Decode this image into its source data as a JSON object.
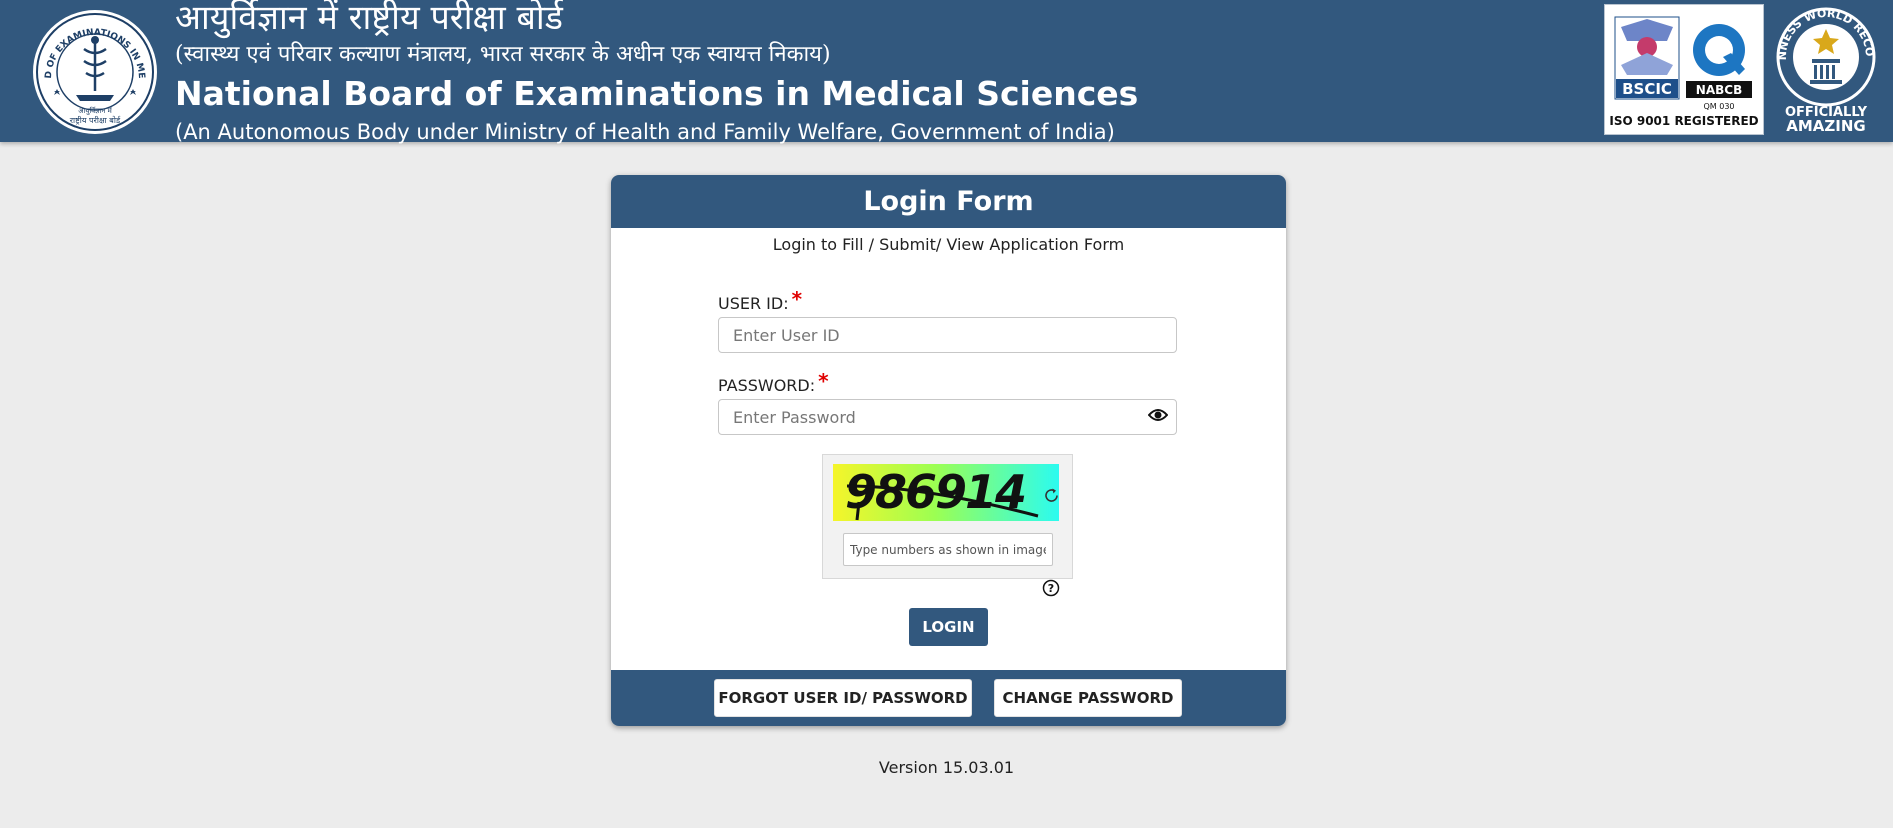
{
  "header": {
    "hindi_title": "आयुर्विज्ञान में राष्ट्रीय परीक्षा बोर्ड",
    "hindi_subtitle": "(स्वास्थ्य एवं परिवार कल्याण मंत्रालय, भारत सरकार के अधीन एक स्वायत्त निकाय)",
    "english_title": "National Board of Examinations in Medical Sciences",
    "english_subtitle": "(An Autonomous Body under Ministry of Health and Family Welfare, Government of India)",
    "logo": {
      "ring_text": "NATIONAL BOARD OF EXAMINATIONS IN MEDICAL SCIENCES",
      "bottom_text_1": "आयुर्विज्ञान में",
      "bottom_text_2": "राष्ट्रीय परीक्षा बोर्ड"
    },
    "iso_badge": {
      "left_label": "BSCIC",
      "right_label": "NABCB",
      "code": "QM 030",
      "registered": "ISO 9001 REGISTERED"
    },
    "guinness_badge": {
      "ring_text": "GUINNESS WORLD RECORDS",
      "line1": "OFFICIALLY",
      "line2": "AMAZING"
    }
  },
  "form": {
    "title": "Login Form",
    "subtitle": "Login to Fill / Submit/ View Application Form",
    "user_id_label": "USER ID:",
    "user_id_placeholder": "Enter User ID",
    "user_id_value": "",
    "password_label": "PASSWORD:",
    "password_placeholder": "Enter Password",
    "password_value": "",
    "required_mark": "*",
    "captcha_text": "986914",
    "captcha_placeholder": "Type numbers as shown in image",
    "captcha_value": "",
    "login_label": "LOGIN",
    "forgot_label": "FORGOT USER ID/ PASSWORD",
    "change_label": "CHANGE PASSWORD"
  },
  "version": "Version 15.03.01",
  "colors": {
    "primary": "#32587e",
    "background": "#ececec",
    "required": "#e00000"
  },
  "icons": [
    "nbe-logo",
    "iso-badge",
    "guinness-badge",
    "eye-icon",
    "refresh-icon",
    "help-icon"
  ]
}
